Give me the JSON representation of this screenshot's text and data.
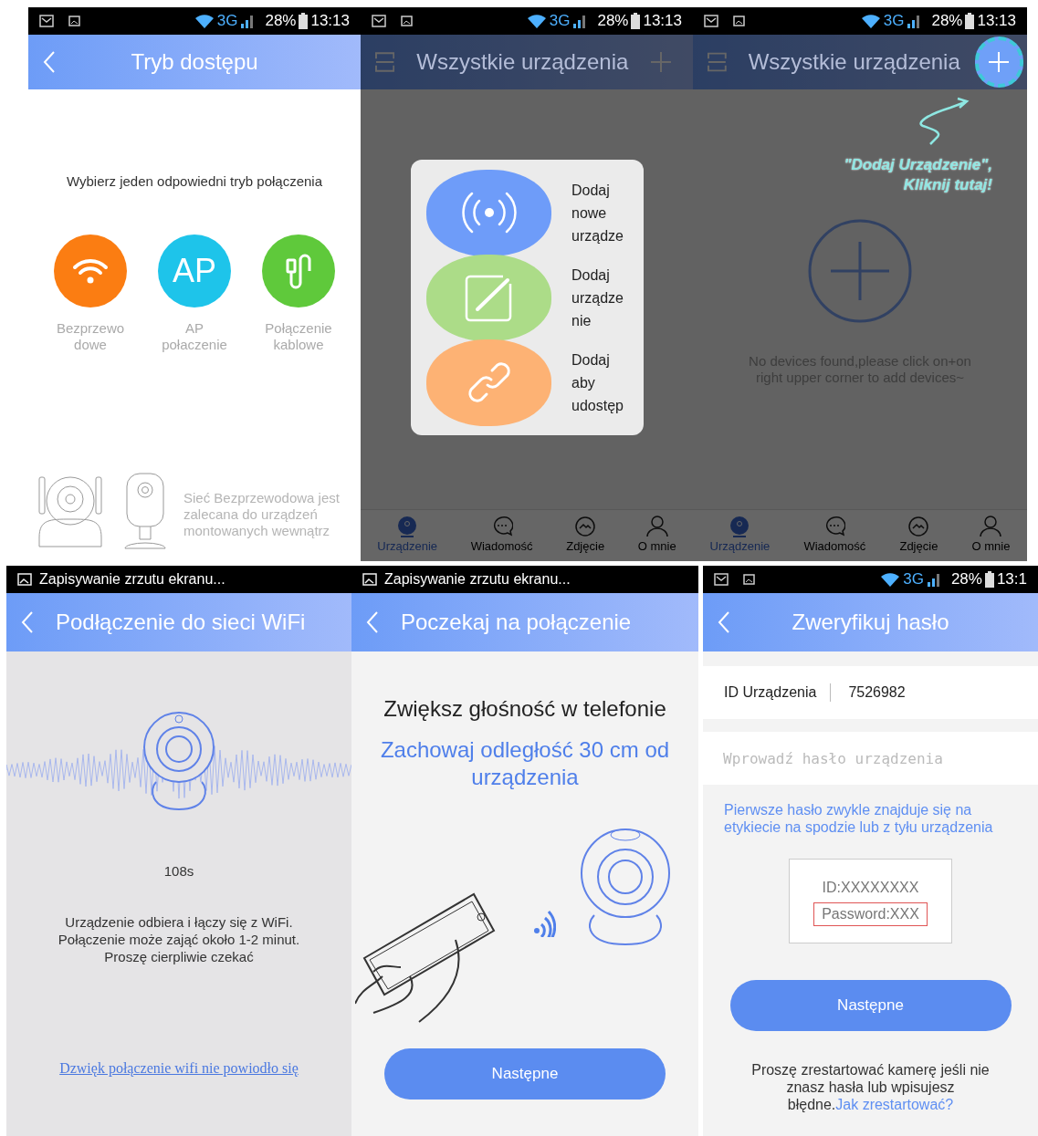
{
  "screens": [
    {
      "kind": "mode_select",
      "status_bar": {
        "kind": "icons",
        "network": "3G",
        "battery": "28%",
        "time": "13:13"
      },
      "header": {
        "title": "Tryb dostępu"
      },
      "prompt": "Wybierz jeden odpowiedni tryb połączenia",
      "modes": [
        {
          "kind": "wifi",
          "color": "#fb7d12",
          "lines": [
            "Bezprzewo",
            "dowe"
          ]
        },
        {
          "kind": "text",
          "icon_text": "AP",
          "color": "#1ec4ea",
          "lines": [
            "AP",
            "połaczenie"
          ]
        },
        {
          "kind": "cable",
          "color": "#5fc93b",
          "lines": [
            "Połączenie",
            "kablowe"
          ]
        }
      ],
      "note": "Sieć Bezprzewodowa jest zalecana do urządzeń montowanych wewnątrz"
    },
    {
      "kind": "devices",
      "dimmed": true,
      "status_bar": {
        "kind": "icons",
        "network": "3G",
        "battery": "28%",
        "time": "13:13"
      },
      "header": {
        "title": "Wszystkie urządzenia",
        "highlighted": false
      },
      "menu": [
        {
          "color": "#6e9cf9",
          "lines": [
            "Dodaj",
            "nowe",
            "urządze"
          ]
        },
        {
          "color": "#acdc88",
          "lines": [
            "Dodaj",
            "urządze",
            "nie"
          ]
        },
        {
          "color": "#fdb274",
          "lines": [
            "Dodaj",
            "aby",
            "udostęp"
          ]
        }
      ],
      "tabs": [
        {
          "label": "Urządzenie",
          "selected": true
        },
        {
          "label": "Wiadomość",
          "selected": false
        },
        {
          "label": "Zdjęcie",
          "selected": false
        },
        {
          "label": "O mnie",
          "selected": false
        }
      ]
    },
    {
      "kind": "devices",
      "dimmed": true,
      "status_bar": {
        "kind": "icons",
        "network": "3G",
        "battery": "28%",
        "time": "13:13"
      },
      "header": {
        "title": "Wszystkie urządzenia",
        "highlighted": true
      },
      "annotation": [
        "\"Dodaj Urządzenie\",",
        "Kliknij tutaj!"
      ],
      "empty_text": "No devices found,please click on+on right upper corner to add devices~",
      "tabs": [
        {
          "label": "Urządzenie",
          "selected": true
        },
        {
          "label": "Wiadomość",
          "selected": false
        },
        {
          "label": "Zdjęcie",
          "selected": false
        },
        {
          "label": "O mnie",
          "selected": false
        }
      ]
    },
    {
      "kind": "sound_wave",
      "status_bar": {
        "kind": "notice",
        "text": "Zapisywanie zrzutu ekranu..."
      },
      "header": {
        "title": "Podłączenie do sieci WiFi"
      },
      "countdown": "108s",
      "message": "Urządzenie odbiera i łączy się z WiFi.\nPołączenie może zająć około 1-2 minut.\nProszę cierpliwie czekać",
      "link": "Dzwięk połączenie wifi nie powiodło się"
    },
    {
      "kind": "wait",
      "status_bar": {
        "kind": "notice",
        "text": "Zapisywanie zrzutu ekranu..."
      },
      "header": {
        "title": "Poczekaj na połączenie"
      },
      "heading": "Zwiększ głośność w telefonie",
      "subheading": "Zachowaj odległość 30 cm od urządzenia",
      "button": "Następne"
    },
    {
      "kind": "verify",
      "status_bar": {
        "kind": "icons",
        "network": "3G",
        "battery": "28%",
        "time": "13:1"
      },
      "header": {
        "title": "Zweryfikuj hasło"
      },
      "id_label": "ID Urządzenia",
      "id_value": "7526982",
      "password": {
        "placeholder": "Wprowadź hasło urządzenia"
      },
      "hint": "Pierwsze hasło zwykle znajduje się na etykiecie na spodzie lub z tyłu urządzenia",
      "label_lines": [
        "ID:XXXXXXXX",
        "Password:XXX"
      ],
      "button": "Następne",
      "restart_text": "Proszę zrestartować kamerę jeśli nie znasz hasła lub wpisujesz błędne.",
      "restart_link": "Jak zrestartować?"
    }
  ]
}
